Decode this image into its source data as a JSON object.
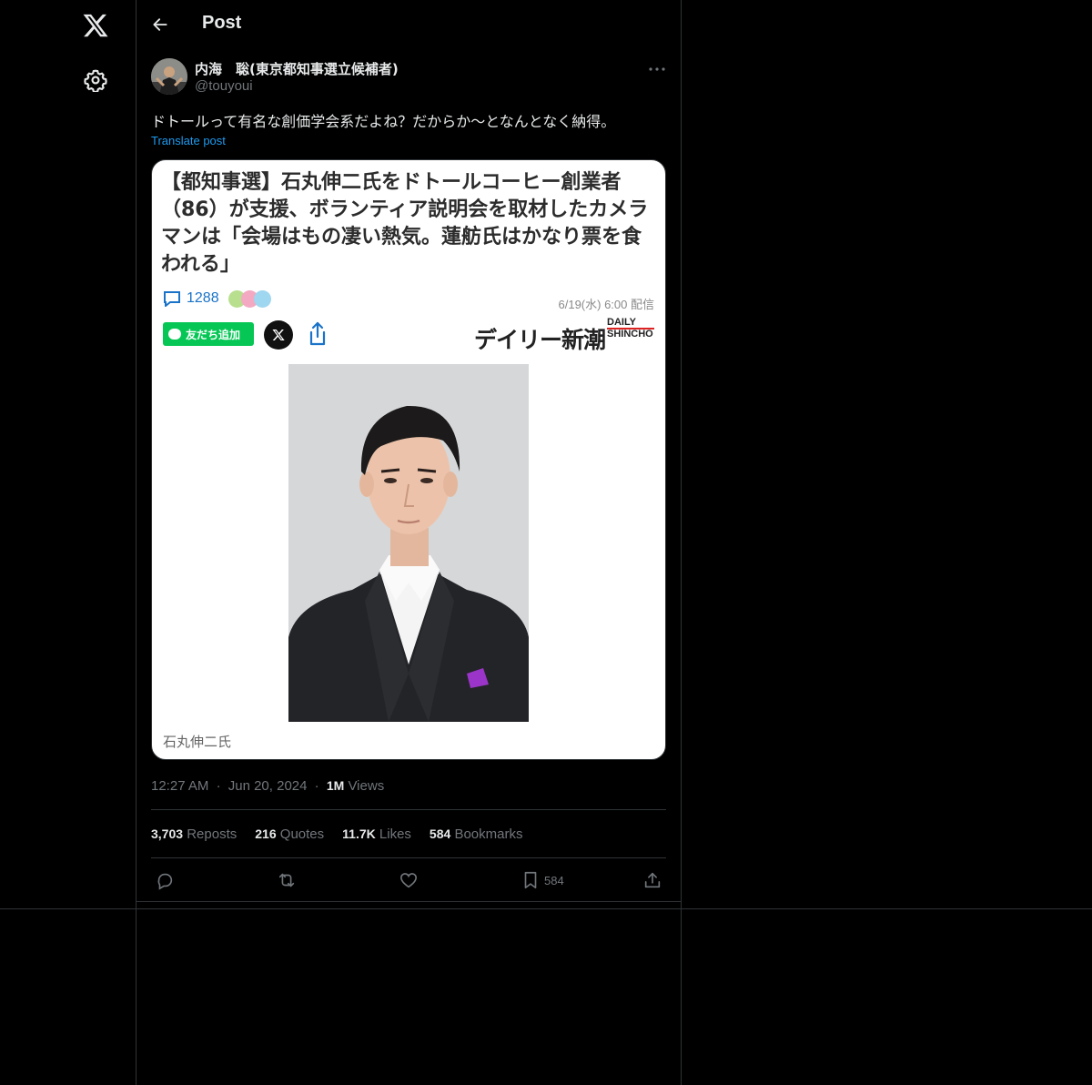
{
  "nav": {
    "logo_icon": "x-logo-icon",
    "settings_icon": "gear-icon"
  },
  "header": {
    "title": "Post",
    "back_icon": "arrow-left-icon"
  },
  "post": {
    "author_name": "内海　聡(東京都知事選立候補者)",
    "author_handle": "@touyoui",
    "text": "ドトールって有名な創価学会系だよね？だからか〜となんとなく納得。",
    "translate_label": "Translate post",
    "timestamp_time": "12:27 AM",
    "timestamp_sep": "·",
    "timestamp_date": "Jun 20, 2024",
    "views_count": "1M",
    "views_label": " Views"
  },
  "media": {
    "headline": "【都知事選】石丸伸二氏をドトールコーヒー創業者（86）が支援、ボランティア説明会を取材したカメラマンは「会場はもの凄い熱気。蓮舫氏はかなり票を食われる」",
    "comment_count": "1288",
    "date": "6/19(水) 6:00 配信",
    "line_button": "友だち追加",
    "publisher_jp": "デイリー新潮",
    "publisher_en_1": "DAILY",
    "publisher_en_2": "SHINCHO",
    "caption": "石丸伸二氏"
  },
  "stats": {
    "reposts_count": "3,703",
    "reposts_label": " Reposts",
    "quotes_count": "216",
    "quotes_label": " Quotes",
    "likes_count": "11.7K",
    "likes_label": " Likes",
    "bookmarks_count": "584",
    "bookmarks_label": " Bookmarks"
  },
  "actions": {
    "bookmark_count": "584"
  },
  "colors": {
    "accent": "#1d9bf0",
    "background": "#000000",
    "border": "#2f3336",
    "muted": "#71767b",
    "line_green": "#06c755"
  }
}
